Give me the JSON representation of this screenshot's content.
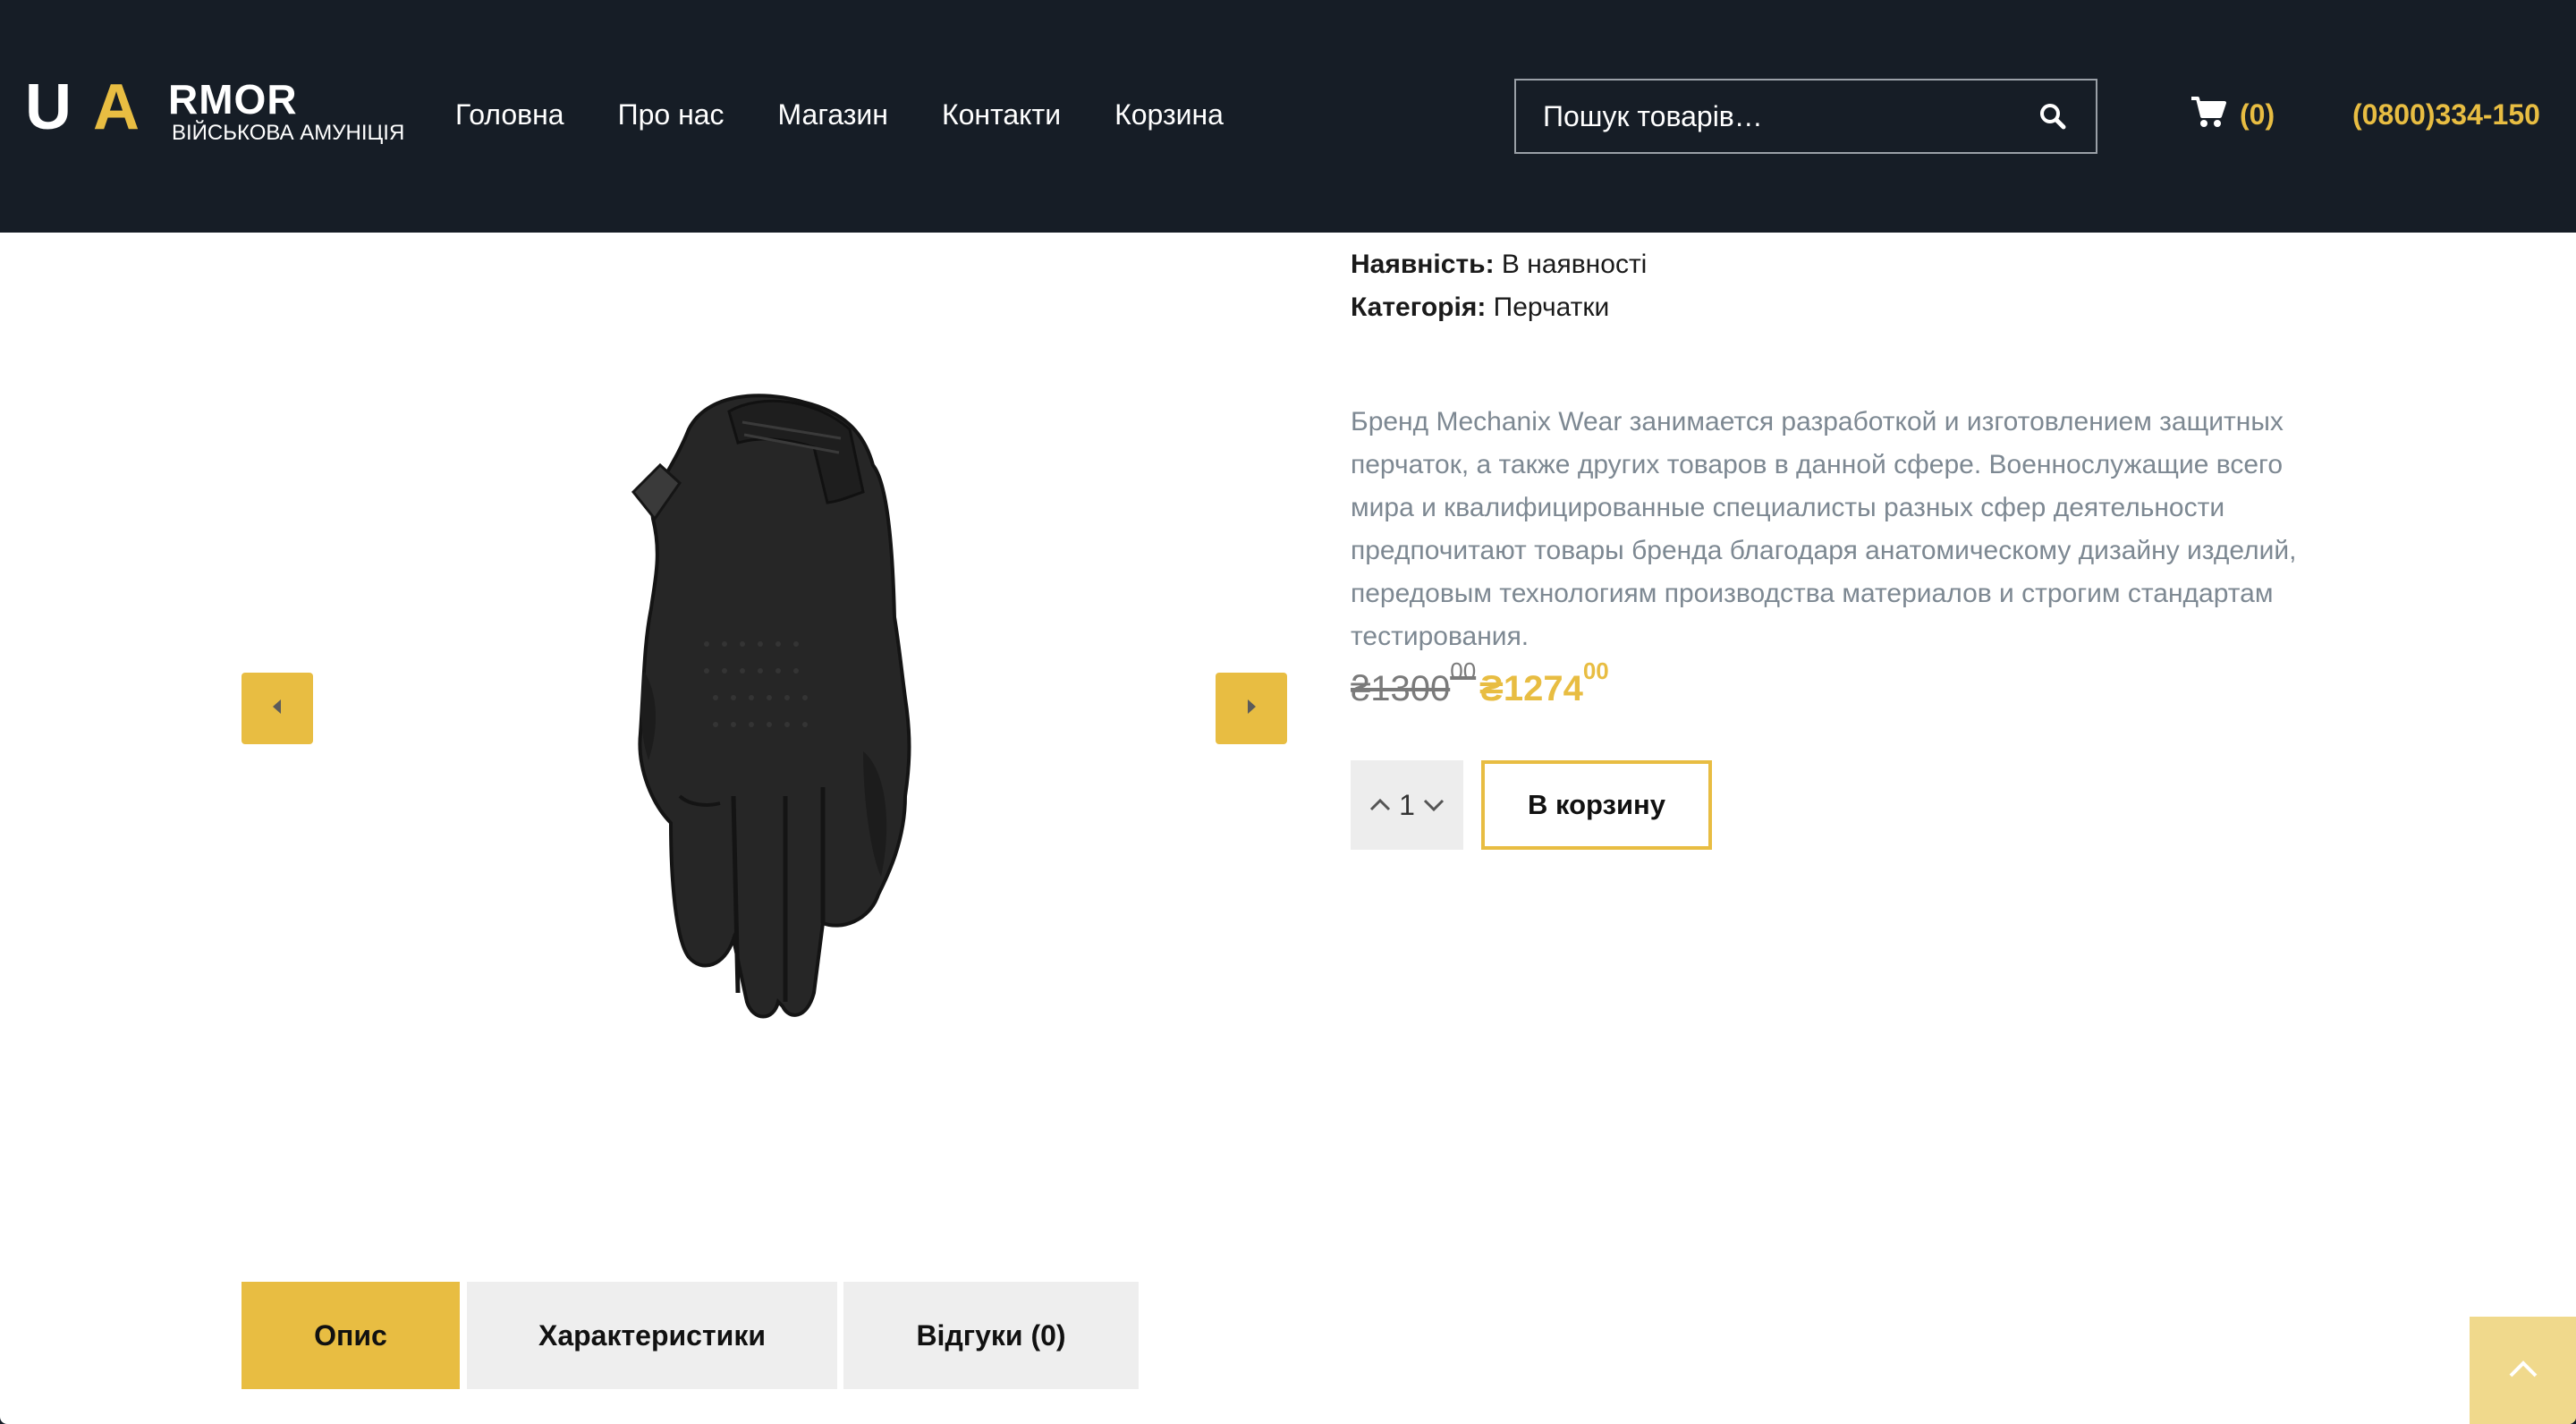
{
  "header": {
    "logo": {
      "big_u": "U",
      "big_a": "A",
      "rest": "RMOR",
      "tagline": "ВІЙСЬКОВА АМУНІЦІЯ"
    },
    "nav": [
      {
        "label": "Головна"
      },
      {
        "label": "Про нас"
      },
      {
        "label": "Магазин"
      },
      {
        "label": "Контакти"
      },
      {
        "label": "Корзина"
      }
    ],
    "search": {
      "placeholder": "Пошук товарів…"
    },
    "cart_count": "(0)",
    "phone": "(0800)334-150"
  },
  "product": {
    "availability_label": "Наявність:",
    "availability_value": "В наявності",
    "category_label": "Категорія:",
    "category_value": "Перчатки",
    "description": "Бренд Mechanix Wear занимается разработкой и изготовлением защитных перчаток, а также других товаров в данной сфере. Военнослужащие всего мира и квалифицированные специалисты разных сфер деятельности предпочитают товары бренда благодаря анатомическому дизайну изделий, передовым технологиям производства материалов и строгим стандартам тестирования.",
    "old_price": "₴1300",
    "old_price_cents": "00",
    "new_price": "₴1274",
    "new_price_cents": "00",
    "quantity": "1",
    "add_to_cart_label": "В корзину"
  },
  "tabs": [
    {
      "label": "Опис",
      "active": true
    },
    {
      "label": "Характеристики",
      "active": false
    },
    {
      "label": "Відгуки (0)",
      "active": false
    }
  ],
  "colors": {
    "header_bg": "#161d26",
    "accent": "#e8bd42",
    "description_text": "#7d8892"
  },
  "icons": {
    "search": "search-icon",
    "cart": "cart-icon",
    "prev": "caret-left-icon",
    "next": "caret-right-icon",
    "qty_up": "chevron-up-icon",
    "qty_down": "chevron-down-icon",
    "scroll_top": "chevron-up-icon"
  }
}
